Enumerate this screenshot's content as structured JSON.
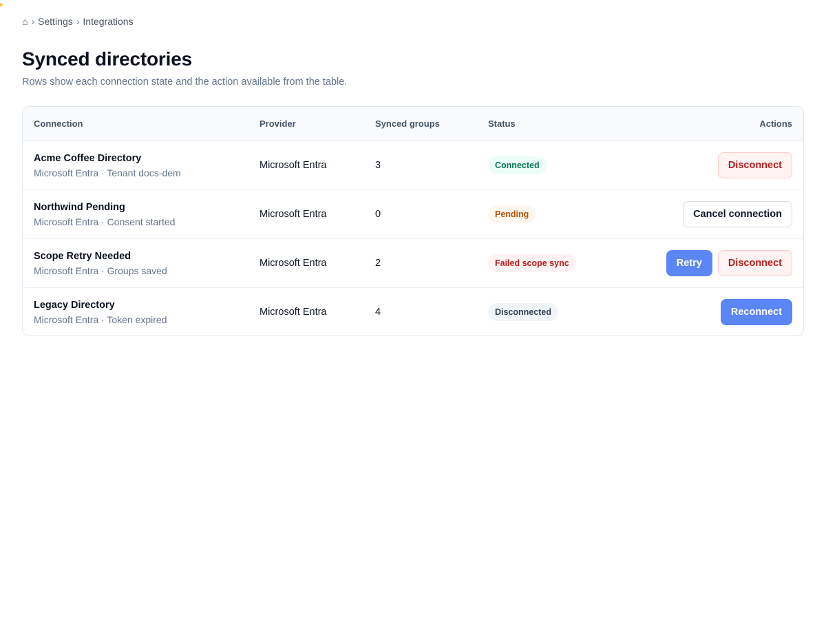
{
  "breadcrumb": {
    "home_icon": "⌂",
    "separator": "›",
    "items": [
      "Settings",
      "Integrations"
    ]
  },
  "page": {
    "title": "Synced directories",
    "subtitle": "Rows show each connection state and the action available from the table."
  },
  "table": {
    "columns": [
      "Connection",
      "Provider",
      "Synced groups",
      "Status",
      "Actions"
    ],
    "rows": [
      {
        "name": "Acme Coffee Directory",
        "detail": "Microsoft Entra · Tenant docs-dem",
        "provider": "Microsoft Entra",
        "synced_groups": "3",
        "status": "Connected",
        "actions": [
          "Disconnect"
        ]
      },
      {
        "name": "Northwind Pending",
        "detail": "Microsoft Entra · Consent started",
        "provider": "Microsoft Entra",
        "synced_groups": "0",
        "status": "Pending",
        "actions": [
          "Cancel connection"
        ]
      },
      {
        "name": "Scope Retry Needed",
        "detail": "Microsoft Entra · Groups saved",
        "provider": "Microsoft Entra",
        "synced_groups": "2",
        "status": "Failed scope sync",
        "actions": [
          "Retry",
          "Disconnect"
        ]
      },
      {
        "name": "Legacy Directory",
        "detail": "Microsoft Entra · Token expired",
        "provider": "Microsoft Entra",
        "synced_groups": "4",
        "status": "Disconnected",
        "actions": [
          "Reconnect"
        ]
      }
    ]
  },
  "colors": {
    "accent": "#5b86f6",
    "success": "#047857",
    "warning": "#b45309",
    "danger": "#b91c1c",
    "neutral": "#334155"
  }
}
